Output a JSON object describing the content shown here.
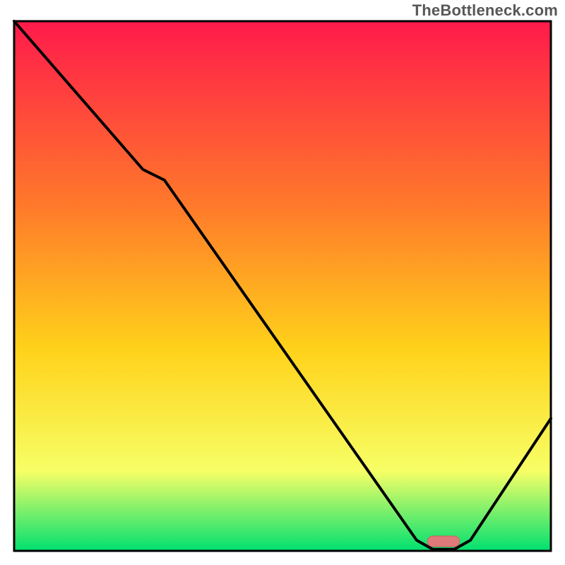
{
  "attribution": "TheBottleneck.com",
  "colors": {
    "gradient_top": "#ff1a4b",
    "gradient_mid1": "#ff7a2a",
    "gradient_mid2": "#ffd21a",
    "gradient_mid3": "#f7ff66",
    "gradient_bottom": "#00e070",
    "curve": "#000000",
    "marker_fill": "#e07a7a",
    "marker_stroke": "#cc5f5f",
    "frame": "#000000"
  },
  "chart_data": {
    "type": "line",
    "title": "",
    "xlabel": "",
    "ylabel": "",
    "x": [
      0,
      24,
      28,
      75,
      78,
      82,
      85,
      100
    ],
    "values": [
      100,
      72,
      70,
      2,
      0.3,
      0.3,
      2,
      25
    ],
    "xlim": [
      0,
      100
    ],
    "ylim": [
      0,
      100
    ],
    "grid": false,
    "marker": {
      "x_center": 80,
      "y": 1.8,
      "width_pct": 6,
      "height_pct": 2
    }
  }
}
